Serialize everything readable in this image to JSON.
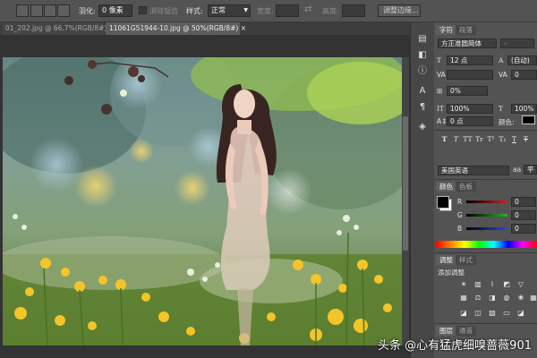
{
  "options_bar": {
    "feather_label": "羽化:",
    "feather_value": "0 像素",
    "antialias_label": "消除锯齿",
    "style_label": "样式:",
    "style_value": "正常",
    "width_label": "宽度:",
    "height_label": "高度:",
    "refine_edge_label": "调整边缘..."
  },
  "tabs": [
    {
      "label": "01_202.jpg @ 66.7%(RGB/8#) ×",
      "active": false
    },
    {
      "label": "11061G51944-10.jpg @ 50%(RGB/8#) ×",
      "active": true
    }
  ],
  "character_panel": {
    "tabs": [
      "字符",
      "段落"
    ],
    "font_family": "方正准圆简体",
    "font_style": "-",
    "font_size": "12 点",
    "leading": "(自动)",
    "kerning": "",
    "tracking": "0",
    "tsume": "0%",
    "vertical_scale": "100%",
    "horizontal_scale": "100%",
    "baseline_shift": "0 点",
    "color_label": "颜色:",
    "type_styles": [
      "T",
      "T",
      "TT",
      "Tr",
      "T¹",
      "T₁",
      "T",
      "T"
    ],
    "language": "美国英语",
    "antialias": "平",
    "antialias_prefix": "aa"
  },
  "color_panel": {
    "tabs": [
      "颜色",
      "色板"
    ],
    "channels": [
      {
        "label": "R",
        "value": "0",
        "color": "#d42020"
      },
      {
        "label": "G",
        "value": "0",
        "color": "#22b822"
      },
      {
        "label": "B",
        "value": "0",
        "color": "#2f45e0"
      }
    ],
    "foreground_color": "#000000",
    "background_color": "#ffffff"
  },
  "adjustments_panel": {
    "tabs": [
      "调整",
      "样式"
    ],
    "title": "添加调整"
  },
  "bottom_tabs": [
    "图层",
    "通道"
  ],
  "watermark": "头条 @心有猛虎细嗅蔷薇901"
}
